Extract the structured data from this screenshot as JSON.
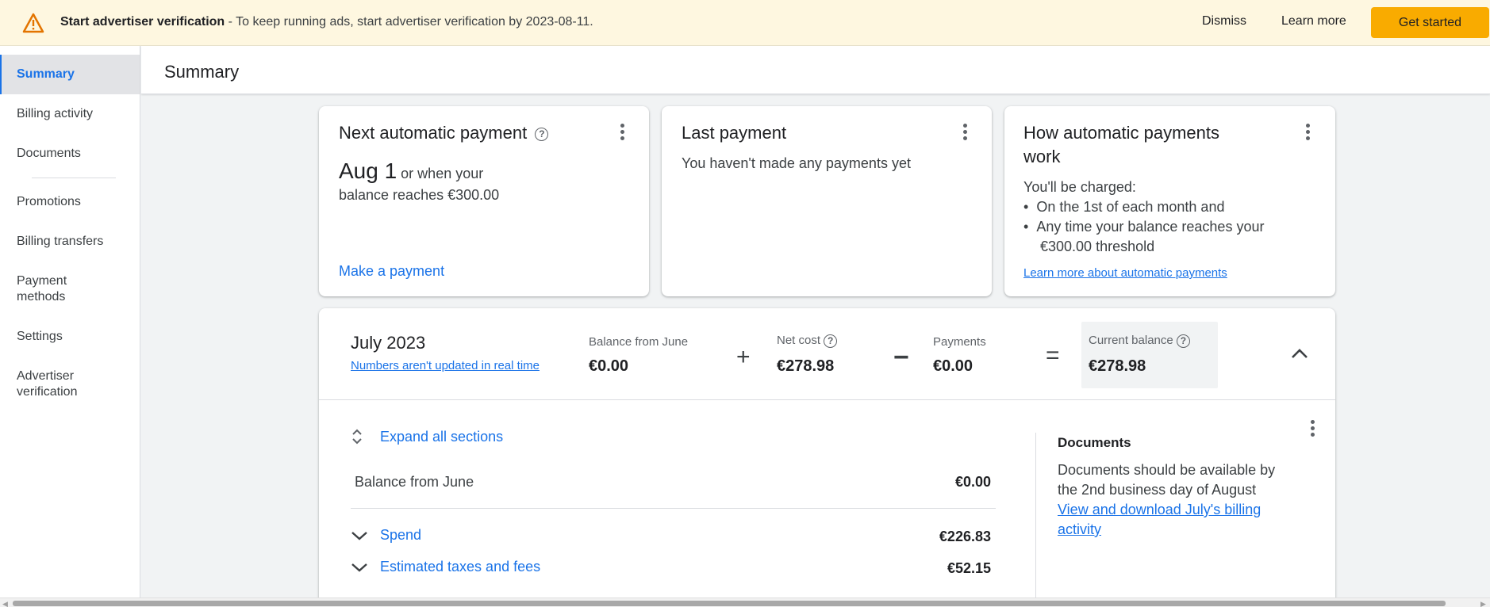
{
  "banner": {
    "title": "Start advertiser verification",
    "message": " - To keep running ads, start advertiser verification by 2023-08-11.",
    "dismiss": "Dismiss",
    "learn_more": "Learn more",
    "get_started": "Get started",
    "accent": "#f9ab00",
    "icon": "warning-icon"
  },
  "sidebar": {
    "items": [
      {
        "label": "Summary"
      },
      {
        "label": "Billing activity"
      },
      {
        "label": "Documents"
      },
      {
        "label": "Promotions"
      },
      {
        "label": "Billing transfers"
      },
      {
        "label": "Payment methods"
      },
      {
        "label": "Settings"
      },
      {
        "label": "Advertiser verification"
      }
    ]
  },
  "header": {
    "title": "Summary"
  },
  "cards": {
    "next_payment": {
      "title": "Next automatic payment",
      "date": "Aug 1",
      "date_suffix": " or when your",
      "line2": "balance reaches €300.00",
      "action": "Make a payment"
    },
    "last_payment": {
      "title": "Last payment",
      "text": "You haven't made any payments yet"
    },
    "how_it_works": {
      "title_line1": "How automatic payments",
      "title_line2": "work",
      "intro": "You'll be charged:",
      "bullet1": "On the 1st of each month and",
      "bullet2_line1": "Any time your balance reaches your",
      "bullet2_line2": "€300.00 threshold",
      "link": "Learn more about automatic payments"
    }
  },
  "month": {
    "title": "July 2023",
    "note": "Numbers aren't updated in real time",
    "balance_from_label": "Balance from June",
    "balance_from_value": "€0.00",
    "plus": "+",
    "net_cost_label": "Net cost",
    "net_cost_value": "€278.98",
    "minus": "−",
    "payments_label": "Payments",
    "payments_value": "€0.00",
    "equals": "=",
    "current_balance_label": "Current balance",
    "current_balance_value": "€278.98"
  },
  "details": {
    "expand_all": "Expand all sections",
    "rows": [
      {
        "label": "Balance from June",
        "value": "€0.00"
      },
      {
        "label": "Spend",
        "value": "€226.83"
      },
      {
        "label": "Estimated taxes and fees",
        "value": "€52.15"
      }
    ],
    "documents": {
      "title": "Documents",
      "text_line1": "Documents should be available by",
      "text_line2": "the 2nd business day of August",
      "link_line1": "View and download July's billing",
      "link_line2": "activity"
    }
  }
}
